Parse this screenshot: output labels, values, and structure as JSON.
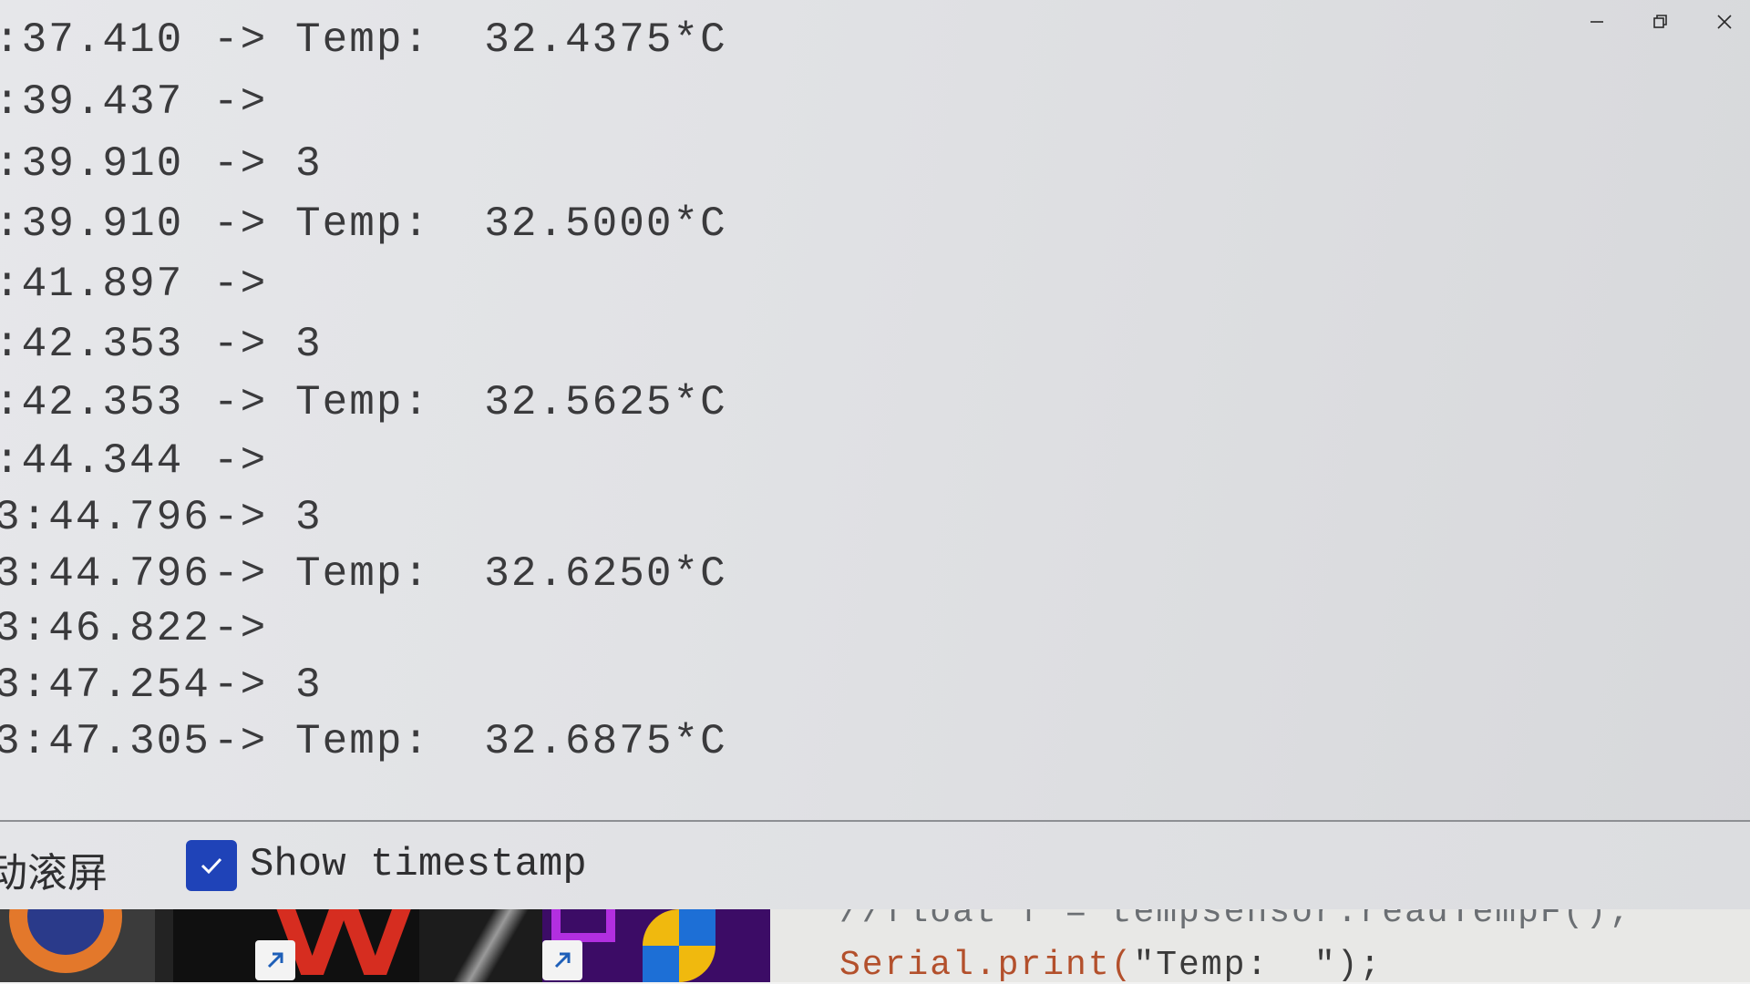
{
  "window": {
    "controls": [
      "minimize-icon",
      "restore-icon",
      "close-icon"
    ]
  },
  "serial_output": {
    "lines": [
      {
        "ts": ":37.410",
        "arrow": "->",
        "msg": "Temp:  32.4375*C"
      },
      {
        "ts": ":39.437",
        "arrow": "->",
        "msg": ""
      },
      {
        "ts": ":39.910",
        "arrow": "->",
        "msg": "3"
      },
      {
        "ts": ":39.910",
        "arrow": "->",
        "msg": "Temp:  32.5000*C"
      },
      {
        "ts": ":41.897",
        "arrow": "->",
        "msg": ""
      },
      {
        "ts": ":42.353",
        "arrow": "->",
        "msg": "3"
      },
      {
        "ts": ":42.353",
        "arrow": "->",
        "msg": "Temp:  32.5625*C"
      },
      {
        "ts": ":44.344",
        "arrow": "->",
        "msg": ""
      },
      {
        "ts": "3:44.796",
        "arrow": "->",
        "msg": "3"
      },
      {
        "ts": "3:44.796",
        "arrow": "->",
        "msg": "Temp:  32.6250*C"
      },
      {
        "ts": "3:46.822",
        "arrow": "->",
        "msg": ""
      },
      {
        "ts": "3:47.254",
        "arrow": "->",
        "msg": "3"
      },
      {
        "ts": "3:47.305",
        "arrow": "->",
        "msg": "Temp:  32.6875*C"
      }
    ]
  },
  "bottom_bar": {
    "autoscroll_label": "动滚屏",
    "show_timestamp_label": "Show timestamp",
    "show_timestamp_checked": true
  },
  "code_editor": {
    "comment_line": "//float f = tempsensor.readTempF();",
    "stmt_prefix": "Serial.print(",
    "stmt_string": "\"Temp:  \"",
    "stmt_suffix": ");"
  },
  "colors": {
    "checkbox": "#1f43b8",
    "code_keyword": "#b3502c"
  }
}
